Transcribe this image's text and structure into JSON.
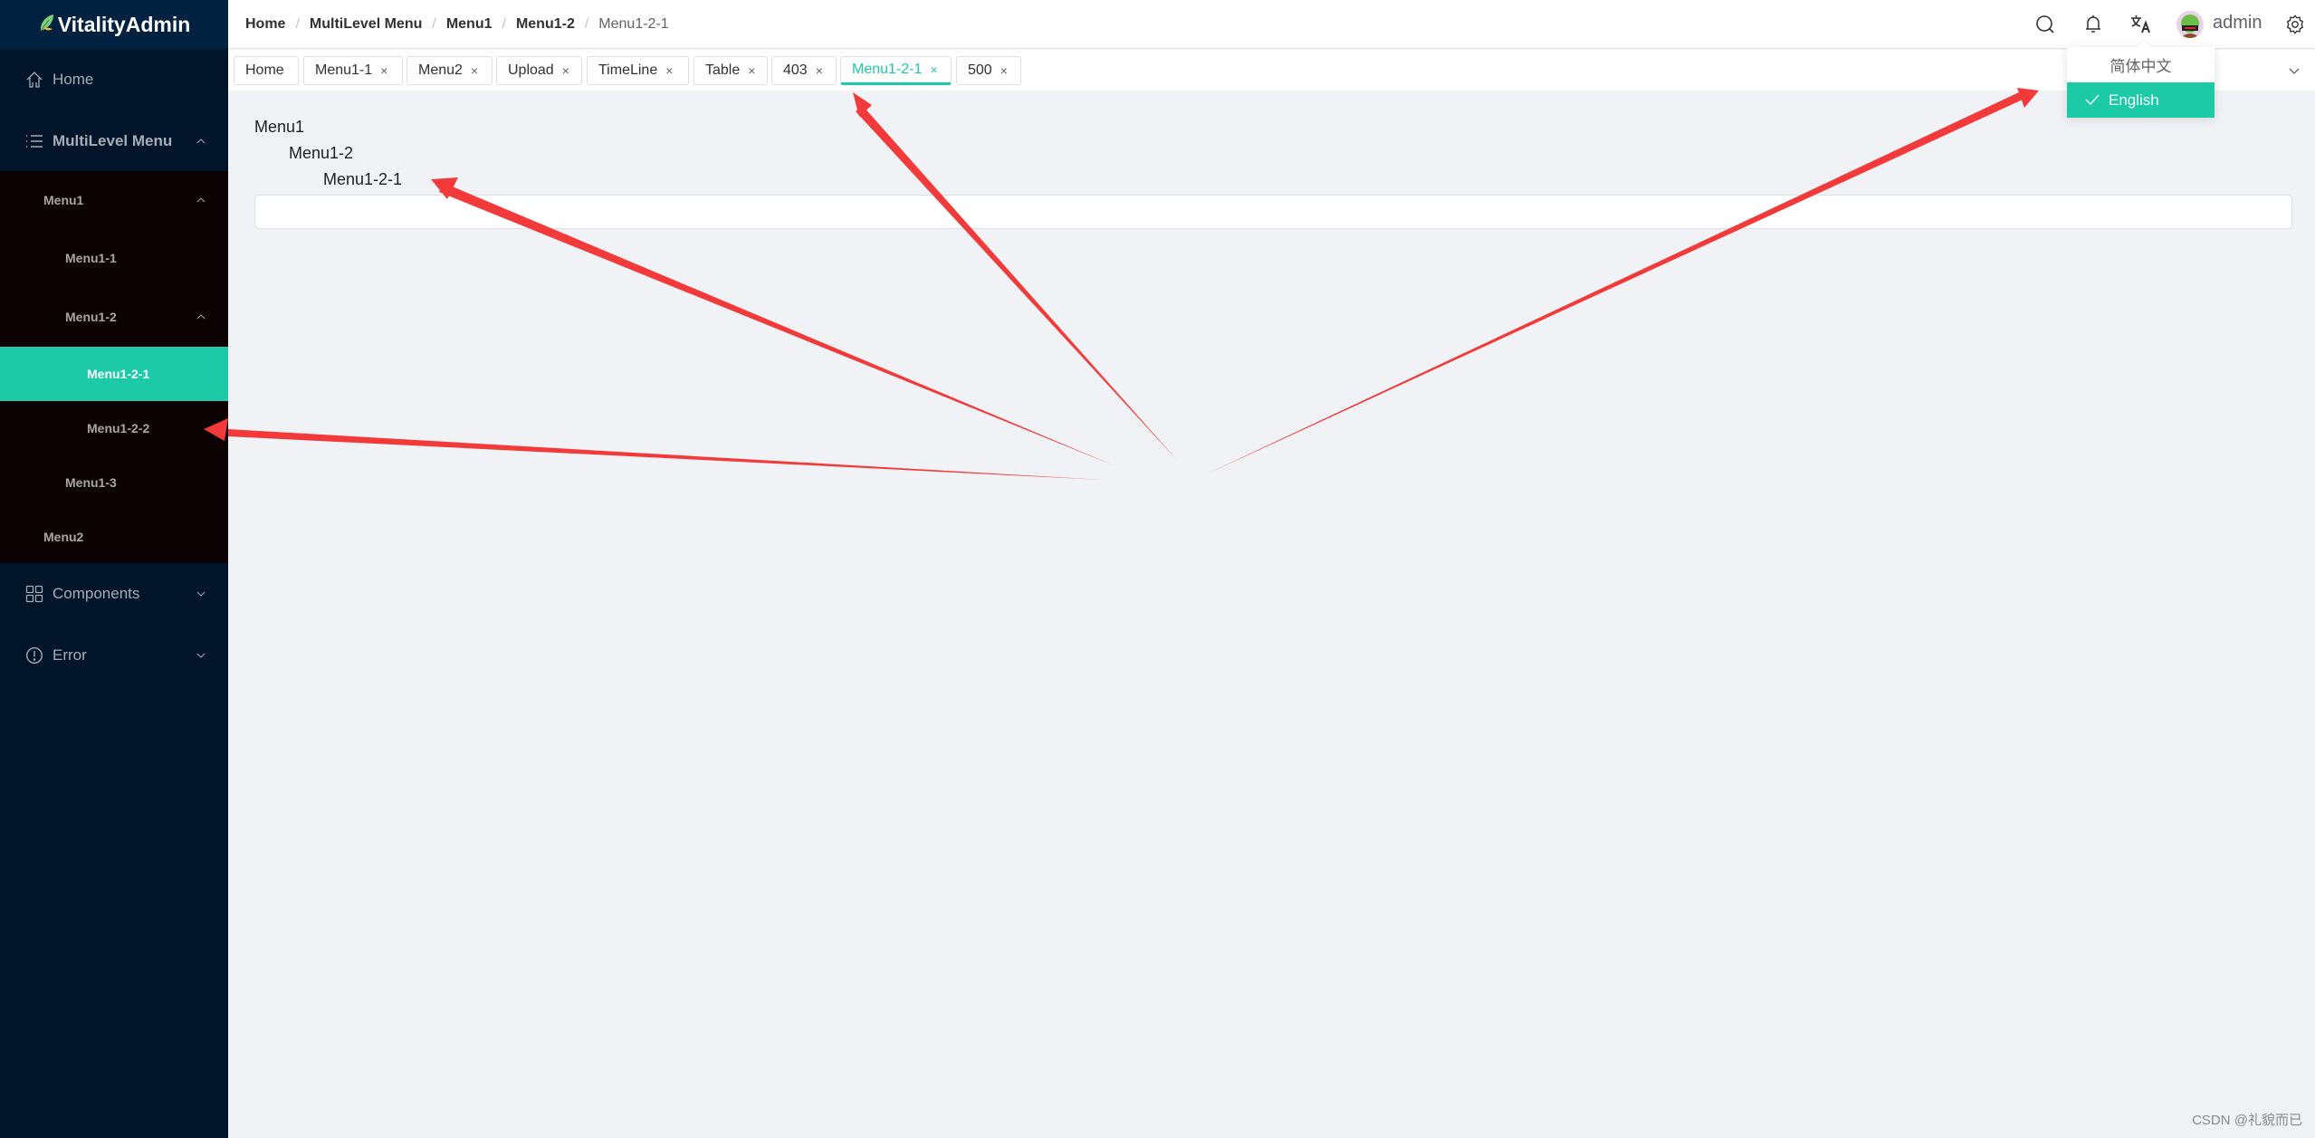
{
  "app": {
    "title": "VitalityAdmin"
  },
  "sidebar": {
    "items": [
      {
        "label": "Home",
        "icon": "home-icon"
      },
      {
        "label": "MultiLevel Menu",
        "icon": "list-icon",
        "expanded": true
      },
      {
        "label": "Components",
        "icon": "grid-icon",
        "expanded": false
      },
      {
        "label": "Error",
        "icon": "alert-circle-icon",
        "expanded": false
      }
    ],
    "submenu": [
      {
        "label": "Menu1",
        "level": 1,
        "expanded": true
      },
      {
        "label": "Menu1-1",
        "level": 2
      },
      {
        "label": "Menu1-2",
        "level": 2,
        "expanded": true
      },
      {
        "label": "Menu1-2-1",
        "level": 3,
        "active": true
      },
      {
        "label": "Menu1-2-2",
        "level": 3
      },
      {
        "label": "Menu1-3",
        "level": 2
      },
      {
        "label": "Menu2",
        "level": 1
      }
    ]
  },
  "header": {
    "breadcrumb": [
      "Home",
      "MultiLevel Menu",
      "Menu1",
      "Menu1-2",
      "Menu1-2-1"
    ],
    "separator": "/",
    "username": "admin"
  },
  "tabs": [
    {
      "label": "Home",
      "closable": false
    },
    {
      "label": "Menu1-1",
      "closable": true
    },
    {
      "label": "Menu2",
      "closable": true
    },
    {
      "label": "Upload",
      "closable": true
    },
    {
      "label": "TimeLine",
      "closable": true
    },
    {
      "label": "Table",
      "closable": true
    },
    {
      "label": "403",
      "closable": true
    },
    {
      "label": "Menu1-2-1",
      "closable": true,
      "active": true
    },
    {
      "label": "500",
      "closable": true
    }
  ],
  "tab_close_glyph": "×",
  "content": {
    "lines": [
      "Menu1",
      "Menu1-2",
      "Menu1-2-1"
    ],
    "input_value": ""
  },
  "language_dropdown": {
    "options": [
      "简体中文",
      "English"
    ],
    "selected": "English"
  },
  "watermark": "CSDN @礼貌而已",
  "colors": {
    "accent": "#1dcaa8",
    "sidebar_bg": "#001529",
    "submenu_bg": "#0d0203",
    "annotation_arrow": "#f23a3a"
  }
}
